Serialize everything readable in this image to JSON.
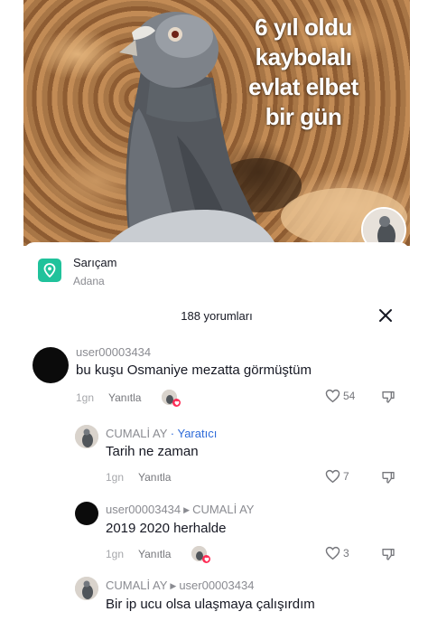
{
  "video": {
    "overlay_lines": [
      "6 yıl oldu",
      "kaybolalı",
      "evlat elbet",
      "bir gün"
    ]
  },
  "location": {
    "name": "Sarıçam",
    "sub": "Adana"
  },
  "comments_header": {
    "count_label": "188 yorumları"
  },
  "comments": [
    {
      "user": "user00003434",
      "text": "bu kuşu Osmaniye mezatta görmüştüm",
      "time": "1gn",
      "reply_label": "Yanıtla",
      "likes": "54"
    },
    {
      "user": "CUMALİ AY",
      "creator_tag": "· Yaratıcı",
      "text": "Tarih ne zaman",
      "time": "1gn",
      "reply_label": "Yanıtla",
      "likes": "7"
    },
    {
      "user": "user00003434",
      "reply_to": "CUMALİ AY",
      "text": "2019 2020 herhalde",
      "time": "1gn",
      "reply_label": "Yanıtla",
      "likes": "3"
    },
    {
      "user": "CUMALİ AY",
      "reply_to": "user00003434",
      "text": "Bir ip ucu olsa ulaşmaya çalışırdım"
    }
  ],
  "colors": {
    "location_icon": "#20c29b",
    "creator_tag": "#2e6bd9",
    "heart_badge": "#fe2c55"
  },
  "icons": [
    "location-pin-icon",
    "close-icon",
    "heart-outline-icon",
    "dislike-icon",
    "reply-arrow-icon"
  ]
}
